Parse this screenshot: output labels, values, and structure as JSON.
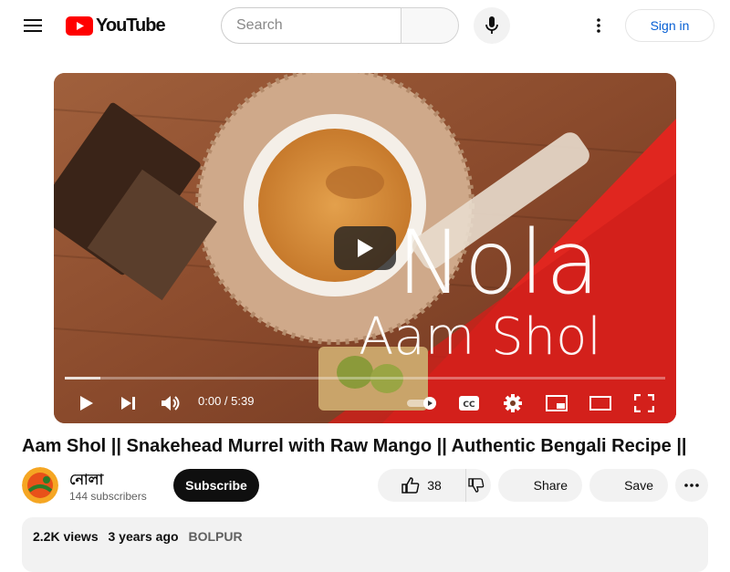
{
  "header": {
    "logo_text": "YouTube",
    "search_placeholder": "Search",
    "signin_label": "Sign in"
  },
  "player": {
    "overlay_title": "Nola",
    "overlay_subtitle": "Aam Shol",
    "current_time": "0:00",
    "duration": "5:39",
    "time_separator": " / ",
    "progress_fraction": 0.06
  },
  "video": {
    "title": "Aam Shol || Snakehead Murrel with Raw Mango || Authentic Bengali Recipe ||",
    "channel_name": "নোলা",
    "subscribers": "144 subscribers",
    "subscribe_label": "Subscribe",
    "like_count": "38",
    "share_label": "Share",
    "save_label": "Save"
  },
  "description": {
    "views": "2.2K views",
    "age": "3 years ago",
    "location": "BOLPUR"
  },
  "colors": {
    "brand_red": "#ff0000",
    "link_blue": "#065fd4"
  }
}
